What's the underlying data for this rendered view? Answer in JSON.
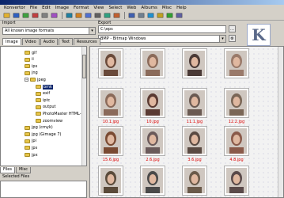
{
  "menu": [
    "Konvertor",
    "File",
    "Edit",
    "Image",
    "Format",
    "View",
    "Select",
    "Web",
    "Albums",
    "Misc",
    "Help"
  ],
  "toolbar_icons": [
    "open-icon",
    "save-icon",
    "copy-icon",
    "paste-icon",
    "delete-icon",
    "cut-icon",
    "undo-icon",
    "convert-icon",
    "zoom-icon",
    "print-icon",
    "slideshow-icon",
    "settings-icon",
    "grid-icon",
    "list-icon",
    "web-icon",
    "help-icon",
    "refresh-icon",
    "back-icon"
  ],
  "import": {
    "label": "Import",
    "format_value": "All known image formats"
  },
  "export": {
    "label": "Export",
    "path_value": "C:\\eps",
    "format_value": "BMP - Bitmap Windows"
  },
  "tabs": [
    "Image",
    "Video",
    "Audio",
    "Text",
    "Resources"
  ],
  "logo_text": "K",
  "tree": [
    {
      "label": "gif"
    },
    {
      "label": "ii"
    },
    {
      "label": "ips"
    },
    {
      "label": "jng"
    },
    {
      "label": "jpeg"
    },
    {
      "label": "bmk",
      "selected": true
    },
    {
      "label": "exif"
    },
    {
      "label": "iptc"
    },
    {
      "label": "output"
    },
    {
      "label": "PhotoMaster HTML-"
    },
    {
      "label": "zoomview"
    },
    {
      "label": "jpg (cmyk)"
    },
    {
      "label": "jpg (Gimage 7)"
    },
    {
      "label": "jpi"
    },
    {
      "label": "jps"
    },
    {
      "label": "jpx"
    }
  ],
  "thumbnails": [
    {
      "caption": "",
      "tone": "#6a4a3a"
    },
    {
      "caption": "",
      "tone": "#8b6b5a"
    },
    {
      "caption": "",
      "tone": "#4a3a36"
    },
    {
      "caption": "",
      "tone": "#9a7a6a"
    },
    {
      "caption": "10.1.jpg",
      "tone": "#8a6a5a"
    },
    {
      "caption": "10.jpg",
      "tone": "#5a3a32"
    },
    {
      "caption": "11.1.jpg",
      "tone": "#6a5a52"
    },
    {
      "caption": "12.2.jpg",
      "tone": "#7a6656"
    },
    {
      "caption": "15.6.jpg",
      "tone": "#7a4a32"
    },
    {
      "caption": "2.6.jpg",
      "tone": "#6a5a5a"
    },
    {
      "caption": "3.6.jpg",
      "tone": "#5a4a42"
    },
    {
      "caption": "4.8.jpg",
      "tone": "#8a5a4a"
    },
    {
      "caption": "",
      "tone": "#5a4a3a"
    },
    {
      "caption": "",
      "tone": "#4a4a4a"
    },
    {
      "caption": "",
      "tone": "#6a5a4a"
    },
    {
      "caption": "",
      "tone": "#5a4a4a"
    }
  ],
  "panel_tabs": [
    "Files",
    "Misc"
  ],
  "selected_files_label": "Selected Files"
}
